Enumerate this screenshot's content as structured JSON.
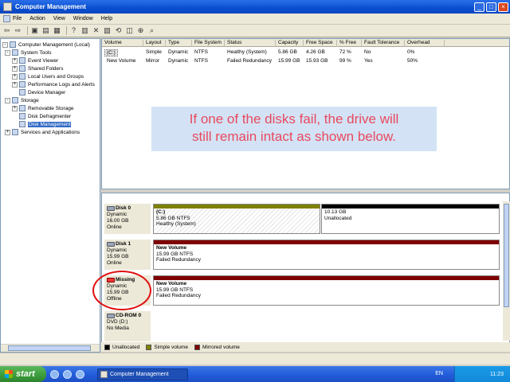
{
  "window": {
    "title": "Computer Management"
  },
  "menu": [
    {
      "label": "File"
    },
    {
      "label": "Action"
    },
    {
      "label": "View"
    },
    {
      "label": "Window"
    },
    {
      "label": "Help"
    }
  ],
  "toolbar_icons": [
    "back-icon",
    "forward-icon",
    "up-icon",
    "show-hide-tree-icon",
    "properties-icon",
    "help-icon",
    "export-icon",
    "delete-icon",
    "properties2-icon",
    "refresh-icon",
    "disk-icon",
    "zoom-icon",
    "search-icon"
  ],
  "tree": [
    {
      "label": "Computer Management (Local)",
      "depth": 0,
      "exp": "-"
    },
    {
      "label": "System Tools",
      "depth": 1,
      "exp": "-"
    },
    {
      "label": "Event Viewer",
      "depth": 2,
      "exp": "+"
    },
    {
      "label": "Shared Folders",
      "depth": 2,
      "exp": "+"
    },
    {
      "label": "Local Users and Groups",
      "depth": 2,
      "exp": "+"
    },
    {
      "label": "Performance Logs and Alerts",
      "depth": 2,
      "exp": "+"
    },
    {
      "label": "Device Manager",
      "depth": 2,
      "exp": ""
    },
    {
      "label": "Storage",
      "depth": 1,
      "exp": "-"
    },
    {
      "label": "Removable Storage",
      "depth": 2,
      "exp": "+"
    },
    {
      "label": "Disk Defragmenter",
      "depth": 2,
      "exp": ""
    },
    {
      "label": "Disk Management",
      "depth": 2,
      "exp": "",
      "selected": true
    },
    {
      "label": "Services and Applications",
      "depth": 1,
      "exp": "+"
    }
  ],
  "volume_columns": [
    "Volume",
    "Layout",
    "Type",
    "File System",
    "Status",
    "Capacity",
    "Free Space",
    "% Free",
    "Fault Tolerance",
    "Overhead"
  ],
  "volumes": [
    [
      "(C:)",
      "Simple",
      "Dynamic",
      "NTFS",
      "Healthy (System)",
      "5.86 GB",
      "4.26 GB",
      "72 %",
      "No",
      "0%"
    ],
    [
      "New Volume",
      "Mirror",
      "Dynamic",
      "NTFS",
      "Failed Redundancy",
      "15.99 GB",
      "15.93 GB",
      "99 %",
      "Yes",
      "50%"
    ]
  ],
  "annotation": {
    "line1": "If one of the disks fail, the drive will",
    "line2": "still remain intact as shown below."
  },
  "disks": [
    {
      "name": "Disk 0",
      "type": "Dynamic",
      "size": "16.00 GB",
      "state": "Online"
    },
    {
      "name": "Disk 1",
      "type": "Dynamic",
      "size": "15.99 GB",
      "state": "Online"
    },
    {
      "name": "Missing",
      "type": "Dynamic",
      "size": "15.99 GB",
      "state": "Offline"
    },
    {
      "name": "CD-ROM 0",
      "type": "DVD (D:)",
      "size": "",
      "state": "No Media"
    }
  ],
  "partitions": {
    "c": {
      "name": "(C:)",
      "size": "5.86 GB NTFS",
      "status": "Healthy (System)"
    },
    "unalloc": {
      "name": "",
      "size": "10.13 GB",
      "status": "Unallocated"
    },
    "nv1": {
      "name": "New Volume",
      "size": "15.99 GB NTFS",
      "status": "Failed Redundancy"
    },
    "nv2": {
      "name": "New Volume",
      "size": "15.99 GB NTFS",
      "status": "Failed Redundancy"
    }
  },
  "legend": [
    {
      "label": "Unallocated",
      "color": "#000000"
    },
    {
      "label": "Simple volume",
      "color": "#808000"
    },
    {
      "label": "Mirrored volume",
      "color": "#800000"
    }
  ],
  "taskbar": {
    "start": "start",
    "task": "Computer Management",
    "lang": "EN",
    "clock": "11:23"
  }
}
